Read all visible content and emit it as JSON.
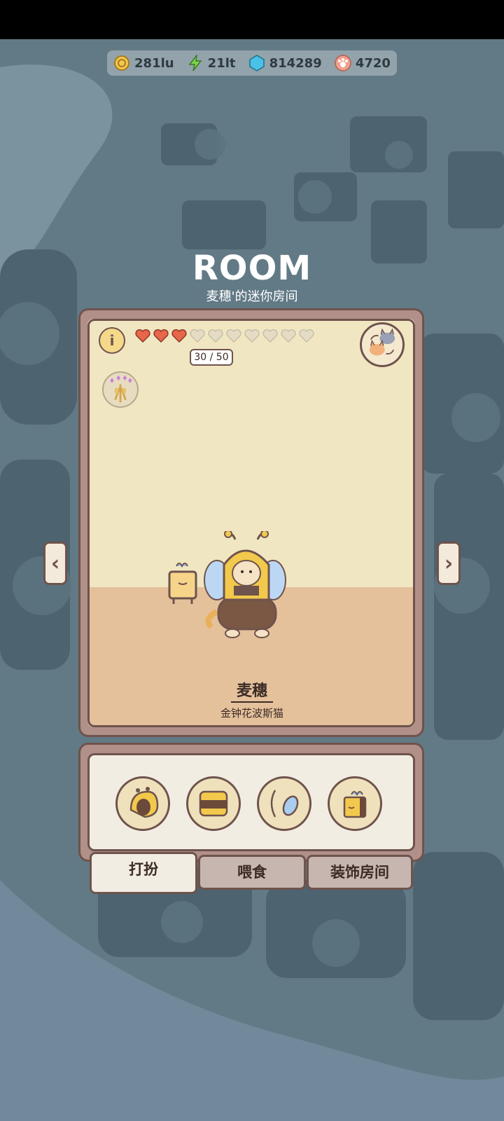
{
  "currencies": [
    {
      "icon": "coin-icon",
      "value": "281lu"
    },
    {
      "icon": "energy-bolt-icon",
      "value": "21lt"
    },
    {
      "icon": "gem-icon",
      "value": "814289"
    },
    {
      "icon": "paw-token-icon",
      "value": "4720"
    }
  ],
  "room": {
    "title": "ROOM",
    "subtitle": "麦穗'的迷你房间",
    "hearts_filled": 3,
    "hearts_total": 10,
    "affection": "30 / 50",
    "info_label": "i",
    "pet_name": "麦穗",
    "pet_breed": "金钟花波斯猫"
  },
  "nav": {
    "prev": "‹",
    "next": "›"
  },
  "tabs": [
    {
      "label": "打扮",
      "active": true
    },
    {
      "label": "喂食",
      "active": false
    },
    {
      "label": "装饰房间",
      "active": false
    }
  ],
  "outfit_items": [
    "bee-hood-icon",
    "bee-body-icon",
    "bee-wings-icon",
    "bee-box-pet-icon"
  ]
}
